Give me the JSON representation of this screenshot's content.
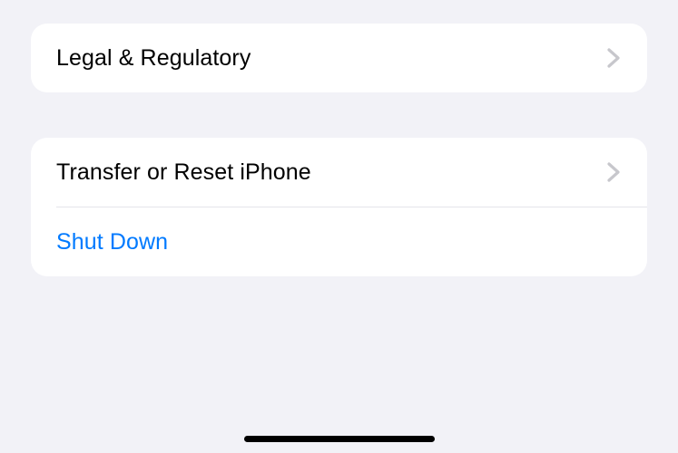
{
  "groups": [
    {
      "rows": [
        {
          "label": "Legal & Regulatory",
          "type": "nav"
        }
      ]
    },
    {
      "rows": [
        {
          "label": "Transfer or Reset iPhone",
          "type": "nav"
        },
        {
          "label": "Shut Down",
          "type": "action"
        }
      ]
    }
  ]
}
